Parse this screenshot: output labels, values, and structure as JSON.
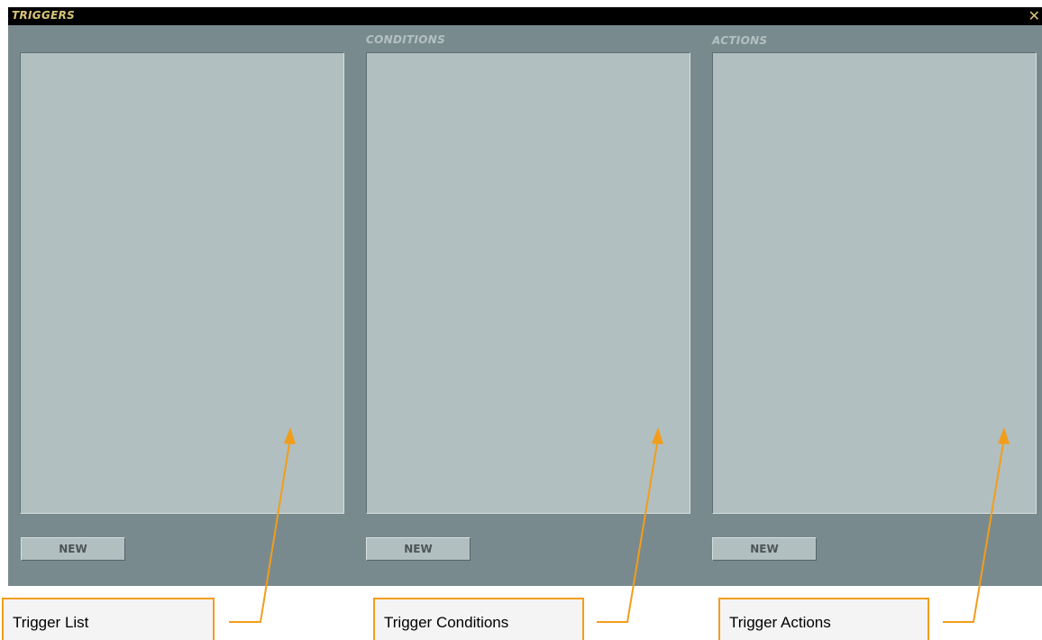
{
  "window": {
    "title": "TRIGGERS",
    "close_glyph": "✕",
    "close_icon": "close-icon"
  },
  "columns": {
    "conditions_label": "CONDITIONS",
    "actions_label": "ACTIONS"
  },
  "buttons": {
    "triggers_new": "NEW",
    "conditions_new": "NEW",
    "actions_new": "NEW"
  },
  "callouts": {
    "trigger_list": "Trigger List",
    "trigger_conditions": "Trigger Conditions",
    "trigger_actions": "Trigger Actions"
  },
  "colors": {
    "accent": "#f29d1a",
    "title_text": "#d9c57a",
    "window_bg": "#798a8e",
    "panel_bg": "#b2bfc0"
  }
}
